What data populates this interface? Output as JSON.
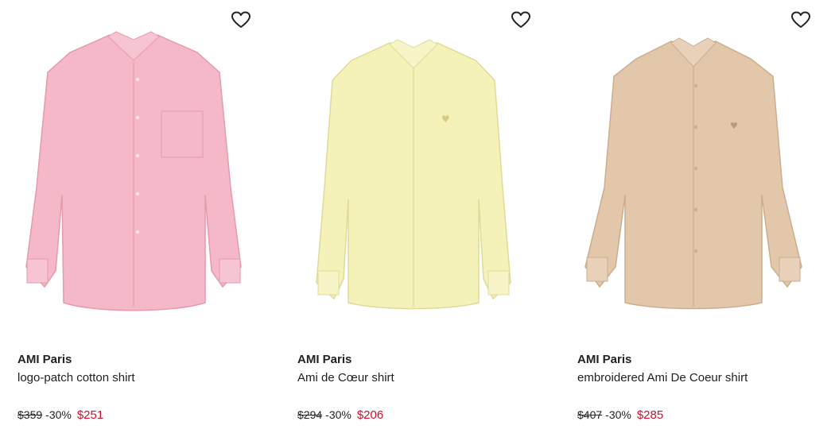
{
  "products": [
    {
      "brand": "AMI Paris",
      "name": "logo-patch cotton shirt",
      "original_price": "$359",
      "discount": "-30%",
      "sale_price": "$251",
      "wishlist_icon": "heart-outline-icon",
      "color": "#f5b8c8"
    },
    {
      "brand": "AMI Paris",
      "name": "Ami de Cœur shirt",
      "original_price": "$294",
      "discount": "-30%",
      "sale_price": "$206",
      "wishlist_icon": "heart-outline-icon",
      "color": "#f4f2b8"
    },
    {
      "brand": "AMI Paris",
      "name": "embroidered Ami De Coeur shirt",
      "original_price": "$407",
      "discount": "-30%",
      "sale_price": "$285",
      "wishlist_icon": "heart-outline-icon",
      "color": "#e2c7aa"
    }
  ]
}
